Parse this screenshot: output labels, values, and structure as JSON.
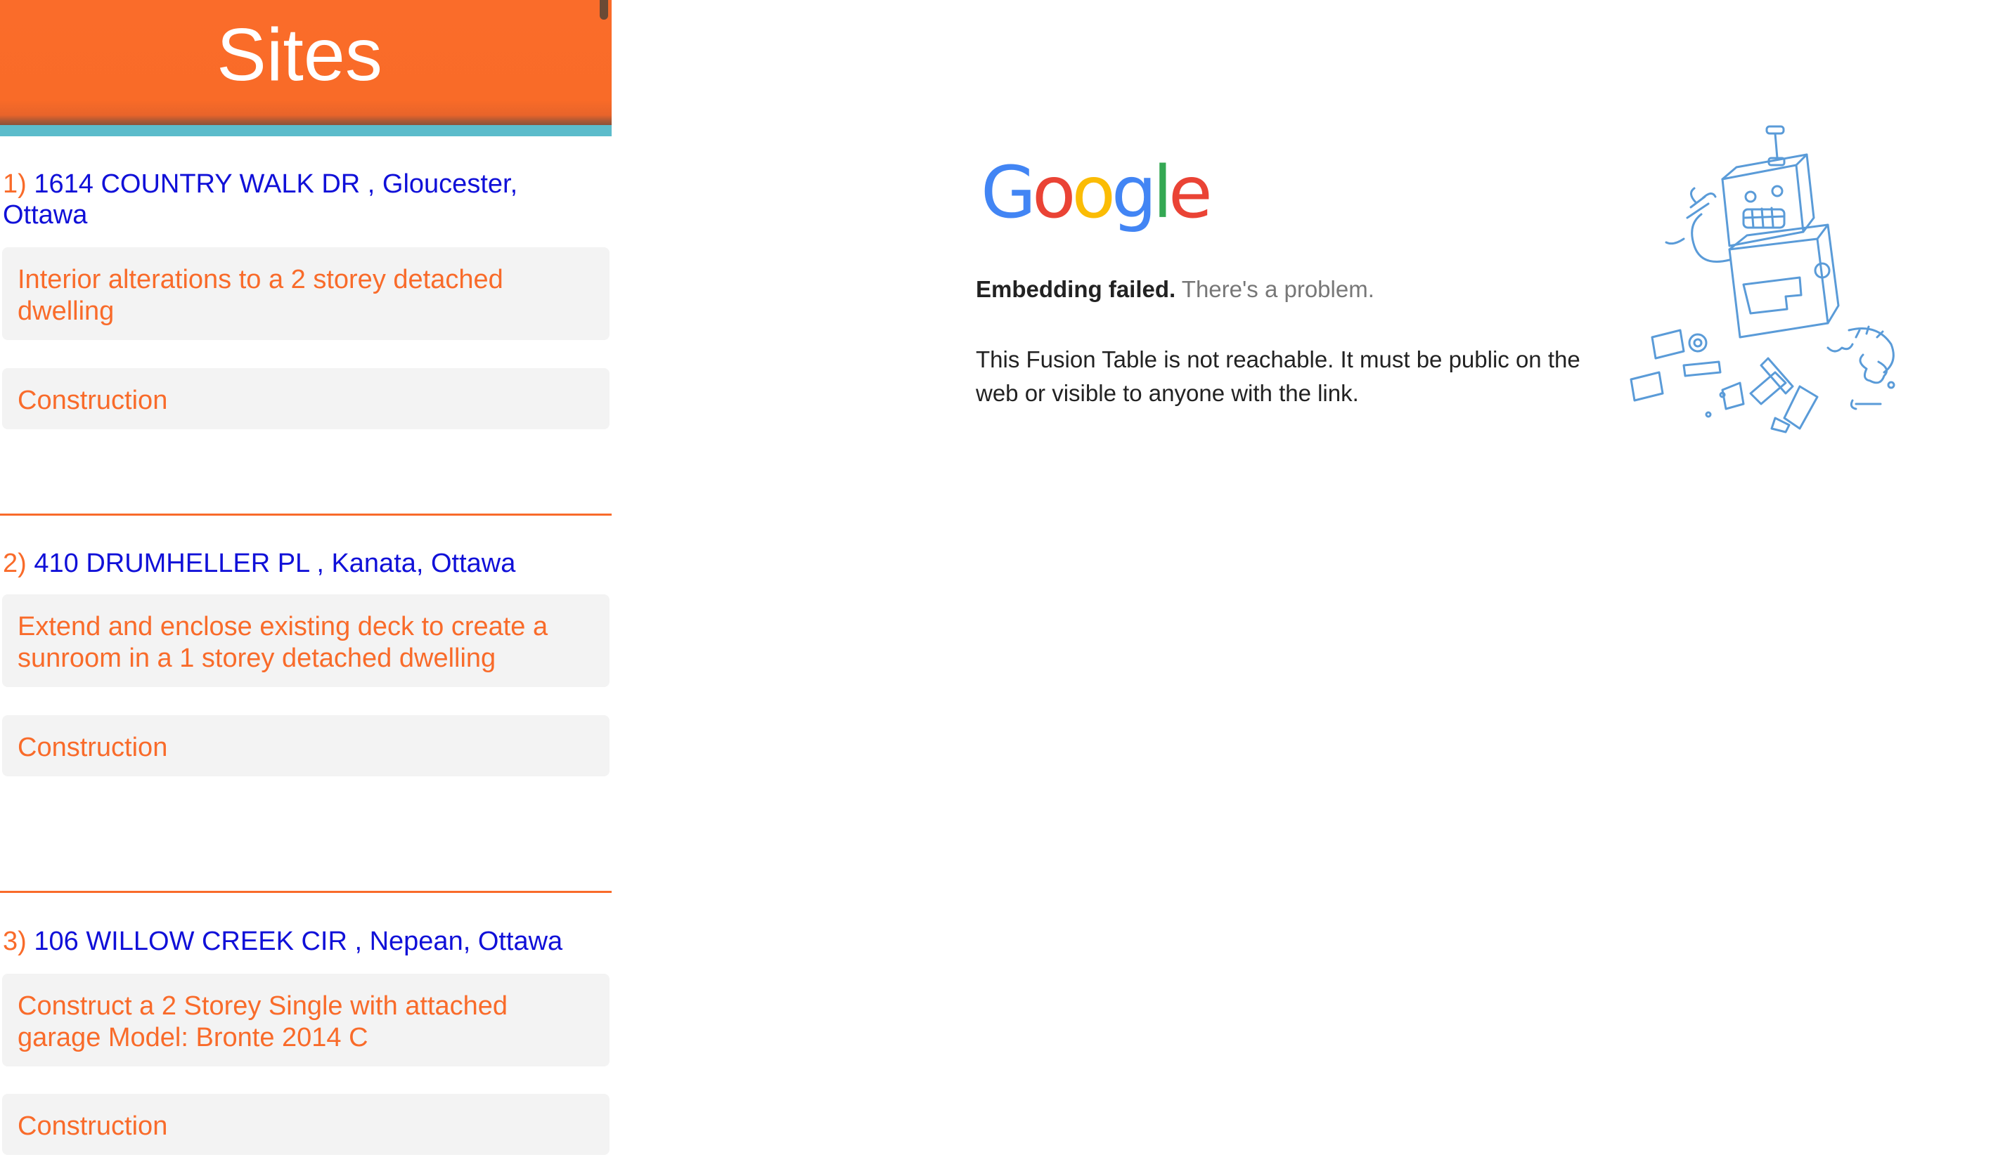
{
  "sidebar": {
    "title": "Sites",
    "sites": [
      {
        "number": "1)",
        "address": "1614 COUNTRY WALK DR , Gloucester, Ottawa",
        "description": "Interior alterations to a 2 storey detached dwelling",
        "type": "Construction"
      },
      {
        "number": "2)",
        "address": "410 DRUMHELLER PL , Kanata, Ottawa",
        "description": "Extend and enclose existing deck to create a sunroom in a 1 storey detached dwelling",
        "type": "Construction"
      },
      {
        "number": "3)",
        "address": "106 WILLOW CREEK CIR , Nepean, Ottawa",
        "description": "Construct a 2 Storey Single with attached garage Model: Bronte 2014 C",
        "type": "Construction"
      }
    ]
  },
  "embed": {
    "logo_letters": [
      "G",
      "o",
      "o",
      "g",
      "l",
      "e"
    ],
    "logo_colors": [
      "#4285F4",
      "#EA4335",
      "#FBBC05",
      "#4285F4",
      "#34A853",
      "#EA4335"
    ],
    "error_title": "Embedding failed.",
    "error_subtitle": "There's a problem.",
    "error_detail": "This Fusion Table is not reachable. It must be public on the web or visible to anyone with the link.",
    "illustration": "broken-robot-icon"
  },
  "colors": {
    "header_orange": "#fa6c2a",
    "header_stripe": "#5cbccb",
    "address_blue": "#1010d8",
    "accent_orange": "#f96b2a",
    "card_background": "#f3f3f3",
    "robot_blue": "#5a9bd8"
  }
}
